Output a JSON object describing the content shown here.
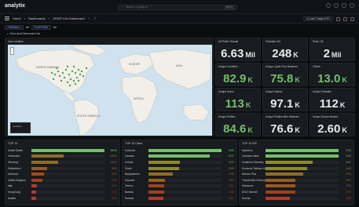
{
  "app": {
    "logo": "analytix"
  },
  "search": {
    "placeholder": "Search or jump to...",
    "shortcut": "ctrl+k"
  },
  "nav": {
    "breadcrumb": [
      "Home",
      "Dashboards",
      "OSINT Info Dashboard"
    ],
    "time_range": "Last 7 days UTC"
  },
  "variables": [
    {
      "label": "FIREWALL",
      "value": "All"
    },
    {
      "label": "PLATFORM",
      "value": "All"
    }
  ],
  "row_title": "Geo and General Info",
  "map": {
    "title": "User Location",
    "labels": {
      "north_america": "NORTH AMERICA",
      "south_america": "SOUTH AMERICA",
      "europe": "EUROPE",
      "africa": "AFRICA",
      "asia": "ASIA"
    },
    "legend_title": "Location"
  },
  "stats": [
    {
      "title": "All Public Firewall",
      "value": "6.63",
      "unit": "Mil",
      "color": "white"
    },
    {
      "title": "Firewalls / All",
      "value": "248",
      "unit": "K",
      "color": "white"
    },
    {
      "title": "Peak / All",
      "value": "2",
      "unit": "Mil",
      "color": "white"
    },
    {
      "title": "Unique Countries",
      "value": "82.9",
      "unit": "K",
      "color": "green"
    },
    {
      "title": "Unique Cyber Pros Reached",
      "value": "75.8",
      "unit": "K",
      "color": "green"
    },
    {
      "title": "Clients",
      "value": "13.0",
      "unit": "K",
      "color": "green"
    },
    {
      "title": "Unique Users",
      "value": "113",
      "unit": "K",
      "color": "green"
    },
    {
      "title": "Unique Visitors",
      "value": "97.1",
      "unit": "K",
      "color": "white"
    },
    {
      "title": "Unique Firewalls",
      "value": "112",
      "unit": "K",
      "color": "white"
    },
    {
      "title": "Unique Profiles",
      "value": "84.6",
      "unit": "K",
      "color": "green"
    },
    {
      "title": "Unique Profiles Who Watched",
      "value": "76.6",
      "unit": "K",
      "color": "white"
    },
    {
      "title": "Unique Device Models",
      "value": "2.60",
      "unit": "K",
      "color": "white"
    }
  ],
  "lists": [
    {
      "title": "TOP 10",
      "rows": [
        {
          "label": "United States",
          "value": "35933",
          "frac": 1.0,
          "color": "#73bf69"
        },
        {
          "label": "Venezuela",
          "value": "15800",
          "frac": 0.44,
          "color": "#8f6c2a"
        },
        {
          "label": "Germany",
          "value": "13302",
          "frac": 0.37,
          "color": "#8f6c2a"
        },
        {
          "label": "Switzerland",
          "value": "8058",
          "frac": 0.22,
          "color": "#9a5a1f"
        },
        {
          "label": "Unknown",
          "value": "6080",
          "frac": 0.17,
          "color": "#a04a1a"
        },
        {
          "label": "United Kingdom",
          "value": "5240",
          "frac": 0.15,
          "color": "#a0411a"
        },
        {
          "label": "Italy",
          "value": "2479",
          "frac": 0.07,
          "color": "#b03a2e"
        },
        {
          "label": "Hong Kong",
          "value": "2121",
          "frac": 0.06,
          "color": "#b03a2e"
        },
        {
          "label": "Austria",
          "value": "2106",
          "frac": 0.06,
          "color": "#b03a2e"
        }
      ]
    },
    {
      "title": "TOP 10 Cities",
      "rows": [
        {
          "label": "Unknown",
          "value": "6080",
          "frac": 1.0,
          "color": "#73bf69"
        },
        {
          "label": "Caracas",
          "value": "5137",
          "frac": 0.84,
          "color": "#73bf69"
        },
        {
          "label": "Central",
          "value": "2625",
          "frac": 0.43,
          "color": "#8f8a2a"
        },
        {
          "label": "Zürich",
          "value": "2545",
          "frac": 0.42,
          "color": "#8f8a2a"
        },
        {
          "label": "Barquisimeto",
          "value": "1996",
          "frac": 0.33,
          "color": "#8f6c2a"
        },
        {
          "label": "Guanare",
          "value": "1381",
          "frac": 0.23,
          "color": "#9a5a1f"
        },
        {
          "label": "Vienna",
          "value": "1254",
          "frac": 0.21,
          "color": "#a0411a"
        },
        {
          "label": "Barinas",
          "value": "1253",
          "frac": 0.21,
          "color": "#a0411a"
        },
        {
          "label": "Pretoria",
          "value": "1202",
          "frac": 0.2,
          "color": "#b03a2e"
        }
      ]
    },
    {
      "title": "TOP 10 ISP",
      "rows": [
        {
          "label": "Spectrum",
          "value": "7229",
          "frac": 1.0,
          "color": "#73bf69"
        },
        {
          "label": "Comcast Cable",
          "value": "7215",
          "frac": 1.0,
          "color": "#73bf69"
        },
        {
          "label": "Vodafone Germany",
          "value": "4631",
          "frac": 0.64,
          "color": "#8f8a2a"
        },
        {
          "label": "Deutsche Telekom AG",
          "value": "4145",
          "frac": 0.57,
          "color": "#8f8a2a"
        },
        {
          "label": "Netcom Plus",
          "value": "3739",
          "frac": 0.52,
          "color": "#8f6c2a"
        },
        {
          "label": "Thunderbird Venezuela",
          "value": "2987",
          "frac": 0.41,
          "color": "#9a5a1f"
        },
        {
          "label": "Swisscom",
          "value": "2938",
          "frac": 0.41,
          "color": "#9a5a1f"
        },
        {
          "label": "AT&T Internet",
          "value": "2939",
          "frac": 0.41,
          "color": "#a0411a"
        },
        {
          "label": "Sunrise",
          "value": "2398",
          "frac": 0.33,
          "color": "#b03a2e"
        }
      ]
    }
  ]
}
